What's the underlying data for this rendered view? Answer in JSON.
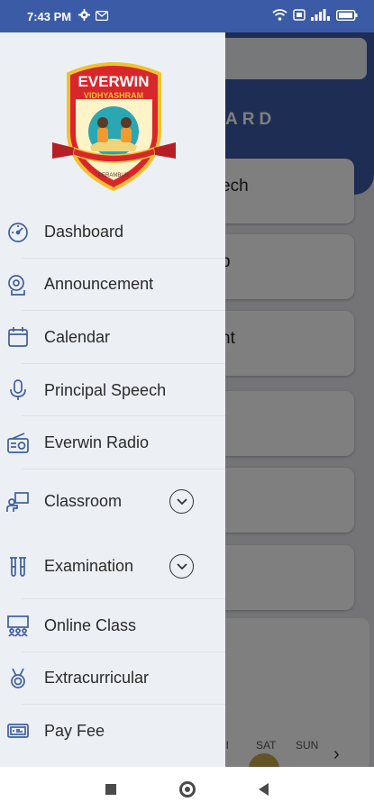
{
  "status_bar": {
    "time": "7:43 PM"
  },
  "background": {
    "header_title": "ARD",
    "cards": [
      "ech",
      "p",
      "nt",
      "",
      "",
      ""
    ],
    "week_days": [
      "RI",
      "SAT",
      "SUN"
    ]
  },
  "drawer": {
    "logo": {
      "name": "EVERWIN",
      "subtitle": "VIDHYASHRAM",
      "location": "PERAMBUR"
    },
    "menu": [
      {
        "label": "Dashboard",
        "icon": "speedometer-icon"
      },
      {
        "label": "Announcement",
        "icon": "megaphone-icon"
      },
      {
        "label": "Calendar",
        "icon": "calendar-icon"
      },
      {
        "label": "Principal Speech",
        "icon": "microphone-icon"
      },
      {
        "label": "Everwin Radio",
        "icon": "radio-icon"
      },
      {
        "label": "Classroom",
        "icon": "classroom-icon",
        "expandable": true
      },
      {
        "label": "Examination",
        "icon": "test-tubes-icon",
        "expandable": true
      },
      {
        "label": "Online Class",
        "icon": "online-class-icon"
      },
      {
        "label": "Extracurricular",
        "icon": "medal-icon"
      },
      {
        "label": "Pay Fee",
        "icon": "banknote-icon"
      }
    ]
  },
  "colors": {
    "primary": "#3c5ba6",
    "drawer_bg": "#eceff4",
    "icon": "#3f5e9f"
  }
}
